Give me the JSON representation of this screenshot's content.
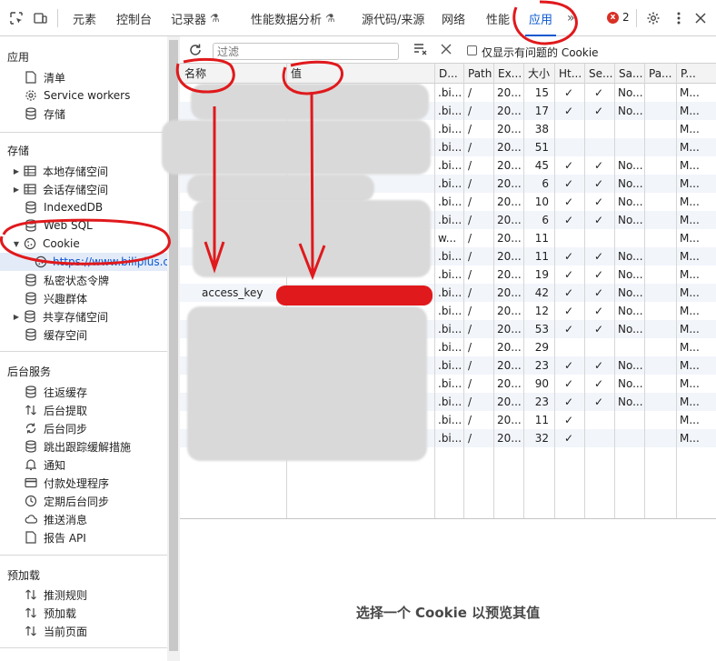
{
  "toolbar": {
    "tabs": [
      {
        "label": "元素",
        "active": false
      },
      {
        "label": "控制台",
        "active": false
      },
      {
        "label": "记录器",
        "active": false,
        "flask": true
      },
      {
        "label": "性能数据分析",
        "active": false,
        "flask": true
      },
      {
        "label": "源代码/来源",
        "active": false
      },
      {
        "label": "网络",
        "active": false
      },
      {
        "label": "性能",
        "active": false
      },
      {
        "label": "应用",
        "active": true
      }
    ],
    "more_tabs": "»",
    "error_count": "2",
    "error_icon": "x",
    "icons": [
      "inspect-icon",
      "device-toggle-icon",
      "settings-icon",
      "more-vert-icon",
      "close-icon"
    ]
  },
  "sidebar": {
    "sections": {
      "app": "应用",
      "storage": "存储",
      "background": "后台服务",
      "preload": "预加载"
    },
    "app_items": [
      "清单",
      "Service workers",
      "存储"
    ],
    "storage_items": [
      "本地存储空间",
      "会话存储空间",
      "IndexedDB",
      "Web SQL",
      "Cookie",
      "https://www.biliplus.com",
      "私密状态令牌",
      "兴趣群体",
      "共享存储空间",
      "缓存空间"
    ],
    "background_items": [
      "往返缓存",
      "后台提取",
      "后台同步",
      "跳出跟踪缓解措施",
      "通知",
      "付款处理程序",
      "定期后台同步",
      "推送消息",
      "报告 API"
    ],
    "preload_items": [
      "推测规则",
      "预加载",
      "当前页面"
    ]
  },
  "filter": {
    "placeholder": "过滤",
    "only_issues_label": "仅显示有问题的 Cookie"
  },
  "table": {
    "headers": [
      "名称",
      "值",
      "D...",
      "Path",
      "Ex...",
      "大小",
      "Ht...",
      "Se...",
      "Sa...",
      "Pa...",
      "P..."
    ],
    "rows": [
      {
        "name": "",
        "domain": ".bi...",
        "path": "/",
        "expires": "20...",
        "size": "15",
        "http": "✓",
        "secure": "✓",
        "same": "No...",
        "p": "M..."
      },
      {
        "name": "",
        "domain": ".bi...",
        "path": "/",
        "expires": "20...",
        "size": "17",
        "http": "✓",
        "secure": "✓",
        "same": "No...",
        "p": "M..."
      },
      {
        "name": "",
        "domain": ".bi...",
        "path": "/",
        "expires": "20...",
        "size": "38",
        "http": "",
        "secure": "",
        "same": "",
        "p": "M..."
      },
      {
        "name": "",
        "domain": ".bi...",
        "path": "/",
        "expires": "20...",
        "size": "51",
        "http": "",
        "secure": "",
        "same": "",
        "p": "M..."
      },
      {
        "name": "",
        "domain": ".bi...",
        "path": "/",
        "expires": "20...",
        "size": "45",
        "http": "✓",
        "secure": "✓",
        "same": "No...",
        "p": "M..."
      },
      {
        "name": "",
        "domain": ".bi...",
        "path": "/",
        "expires": "20...",
        "size": "6",
        "http": "✓",
        "secure": "✓",
        "same": "No...",
        "p": "M..."
      },
      {
        "name": "",
        "domain": ".bi...",
        "path": "/",
        "expires": "20...",
        "size": "10",
        "http": "✓",
        "secure": "✓",
        "same": "No...",
        "p": "M..."
      },
      {
        "name": "",
        "domain": ".bi...",
        "path": "/",
        "expires": "20...",
        "size": "6",
        "http": "✓",
        "secure": "✓",
        "same": "No...",
        "p": "M..."
      },
      {
        "name": "",
        "domain": "w...",
        "path": "/",
        "expires": "20...",
        "size": "11",
        "http": "",
        "secure": "",
        "same": "",
        "p": "M..."
      },
      {
        "name": "",
        "domain": ".bi...",
        "path": "/",
        "expires": "20...",
        "size": "11",
        "http": "✓",
        "secure": "✓",
        "same": "No...",
        "p": "M..."
      },
      {
        "name": "",
        "domain": ".bi...",
        "path": "/",
        "expires": "20...",
        "size": "19",
        "http": "✓",
        "secure": "✓",
        "same": "No...",
        "p": "M..."
      },
      {
        "name": "access_key",
        "domain": ".bi...",
        "path": "/",
        "expires": "20...",
        "size": "42",
        "http": "✓",
        "secure": "✓",
        "same": "No...",
        "p": "M..."
      },
      {
        "name": "",
        "domain": ".bi...",
        "path": "/",
        "expires": "20...",
        "size": "12",
        "http": "✓",
        "secure": "✓",
        "same": "No...",
        "p": "M..."
      },
      {
        "name": "",
        "domain": ".bi...",
        "path": "/",
        "expires": "20...",
        "size": "53",
        "http": "✓",
        "secure": "✓",
        "same": "No...",
        "p": "M..."
      },
      {
        "name": "",
        "domain": ".bi...",
        "path": "/",
        "expires": "20...",
        "size": "29",
        "http": "",
        "secure": "",
        "same": "",
        "p": "M..."
      },
      {
        "name": "",
        "domain": ".bi...",
        "path": "/",
        "expires": "20...",
        "size": "23",
        "http": "✓",
        "secure": "✓",
        "same": "No...",
        "p": "M..."
      },
      {
        "name": "",
        "domain": ".bi...",
        "path": "/",
        "expires": "20...",
        "size": "90",
        "http": "✓",
        "secure": "✓",
        "same": "No...",
        "p": "M..."
      },
      {
        "name": "",
        "domain": ".bi...",
        "path": "/",
        "expires": "20...",
        "size": "23",
        "http": "✓",
        "secure": "✓",
        "same": "No...",
        "p": "M..."
      },
      {
        "name": "",
        "domain": ".bi...",
        "path": "/",
        "expires": "20...",
        "size": "11",
        "http": "✓",
        "secure": "",
        "same": "",
        "p": "M..."
      },
      {
        "name": "",
        "domain": ".bi...",
        "path": "/",
        "expires": "20...",
        "size": "32",
        "http": "✓",
        "secure": "",
        "same": "",
        "p": "M..."
      }
    ]
  },
  "preview": {
    "empty_text": "选择一个 Cookie 以预览其值"
  },
  "colors": {
    "accent": "#0b57d0",
    "error": "#d93025",
    "annotation_red": "#e0191c",
    "redaction_gray": "#d9d9d9"
  }
}
